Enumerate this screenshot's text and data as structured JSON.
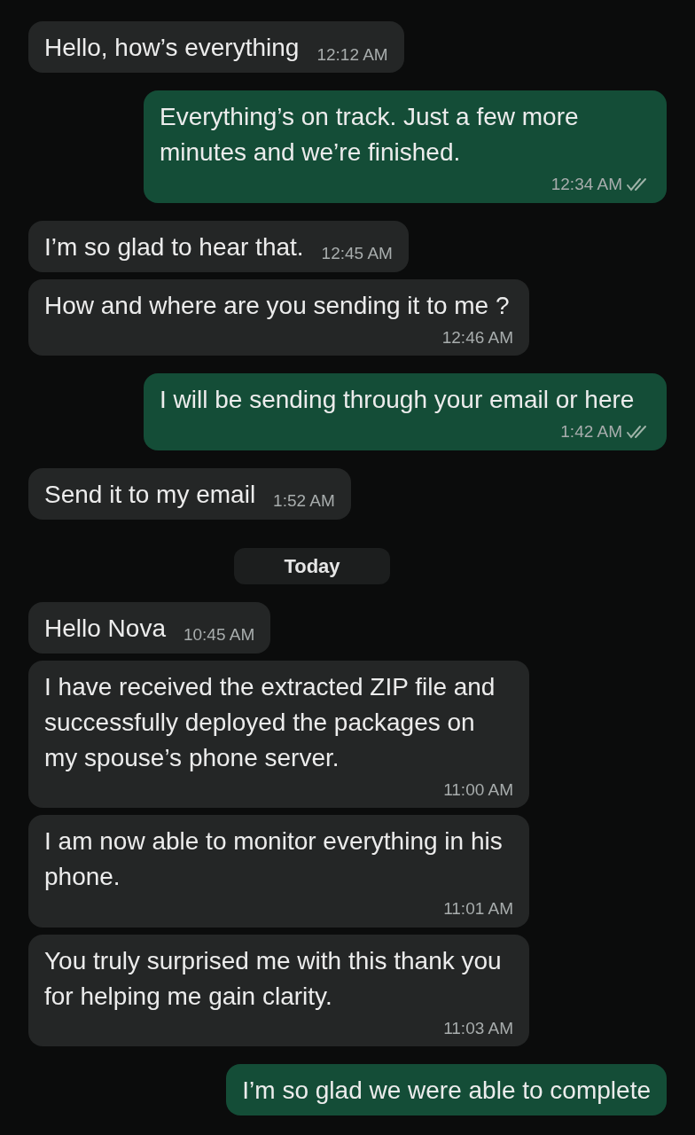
{
  "messages": [
    {
      "kind": "incoming",
      "text": "Hello, how’s everything",
      "time": "12:12 AM"
    },
    {
      "kind": "outgoing",
      "text": "Everything’s on track. Just a few more minutes and we’re finished.",
      "time": "12:34 AM",
      "read": false
    },
    {
      "kind": "incoming",
      "text": "I’m so glad to hear that.",
      "time": "12:45 AM"
    },
    {
      "kind": "incoming",
      "text": "How and where are you sending it to me ?",
      "time": "12:46 AM"
    },
    {
      "kind": "outgoing",
      "text": "I will be sending through your email or here",
      "time": "1:42 AM",
      "read": false
    },
    {
      "kind": "incoming",
      "text": "Send it to my email",
      "time": "1:52 AM"
    },
    {
      "kind": "date",
      "text": "Today"
    },
    {
      "kind": "incoming",
      "text": "Hello Nova",
      "time": "10:45 AM"
    },
    {
      "kind": "incoming",
      "text": "I have received the extracted ZIP file and successfully deployed the packages on my spouse’s phone server.",
      "time": "11:00 AM"
    },
    {
      "kind": "incoming",
      "text": "I am now able to monitor everything in his phone.",
      "time": "11:01 AM"
    },
    {
      "kind": "incoming",
      "text": "You truly surprised me with this thank you for helping me gain clarity.",
      "time": "11:03 AM"
    },
    {
      "kind": "outgoing",
      "text": "I’m so glad we were able to complete"
    }
  ]
}
